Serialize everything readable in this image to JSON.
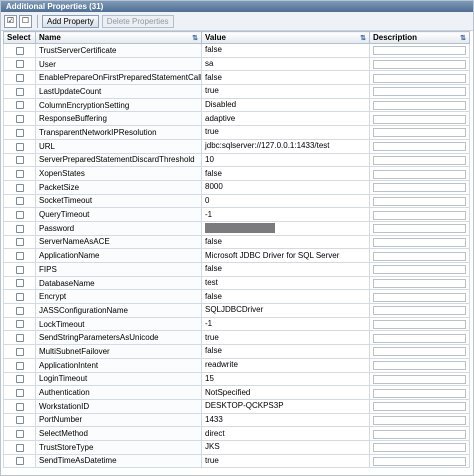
{
  "panel": {
    "title": "Additional Properties (31)"
  },
  "toolbar": {
    "select_all_icon": "select-all-icon",
    "deselect_all_icon": "deselect-all-icon",
    "add_label": "Add Property",
    "delete_label": "Delete Properties"
  },
  "columns": {
    "select": "Select",
    "name": "Name",
    "value": "Value",
    "description": "Description"
  },
  "rows": [
    {
      "name": "TrustServerCertificate",
      "value": "false"
    },
    {
      "name": "User",
      "value": "sa"
    },
    {
      "name": "EnablePrepareOnFirstPreparedStatementCall",
      "value": "false"
    },
    {
      "name": "LastUpdateCount",
      "value": "true"
    },
    {
      "name": "ColumnEncryptionSetting",
      "value": "Disabled"
    },
    {
      "name": "ResponseBuffering",
      "value": "adaptive"
    },
    {
      "name": "TransparentNetworkIPResolution",
      "value": "true"
    },
    {
      "name": "URL",
      "value": "jdbc:sqlserver://127.0.0.1:1433/test"
    },
    {
      "name": "ServerPreparedStatementDiscardThreshold",
      "value": "10"
    },
    {
      "name": "XopenStates",
      "value": "false"
    },
    {
      "name": "PacketSize",
      "value": "8000"
    },
    {
      "name": "SocketTimeout",
      "value": "0"
    },
    {
      "name": "QueryTimeout",
      "value": "-1"
    },
    {
      "name": "Password",
      "value": "",
      "masked": true
    },
    {
      "name": "ServerNameAsACE",
      "value": "false"
    },
    {
      "name": "ApplicationName",
      "value": "Microsoft JDBC Driver for SQL Server"
    },
    {
      "name": "FIPS",
      "value": "false"
    },
    {
      "name": "DatabaseName",
      "value": "test"
    },
    {
      "name": "Encrypt",
      "value": "false"
    },
    {
      "name": "JASSConfigurationName",
      "value": "SQLJDBCDriver"
    },
    {
      "name": "LockTimeout",
      "value": "-1"
    },
    {
      "name": "SendStringParametersAsUnicode",
      "value": "true"
    },
    {
      "name": "MultiSubnetFailover",
      "value": "false"
    },
    {
      "name": "ApplicationIntent",
      "value": "readwrite"
    },
    {
      "name": "LoginTimeout",
      "value": "15"
    },
    {
      "name": "Authentication",
      "value": "NotSpecified"
    },
    {
      "name": "WorkstationID",
      "value": "DESKTOP-QCKPS3P"
    },
    {
      "name": "PortNumber",
      "value": "1433"
    },
    {
      "name": "SelectMethod",
      "value": "direct"
    },
    {
      "name": "TrustStoreType",
      "value": "JKS"
    },
    {
      "name": "SendTimeAsDatetime",
      "value": "true"
    }
  ]
}
